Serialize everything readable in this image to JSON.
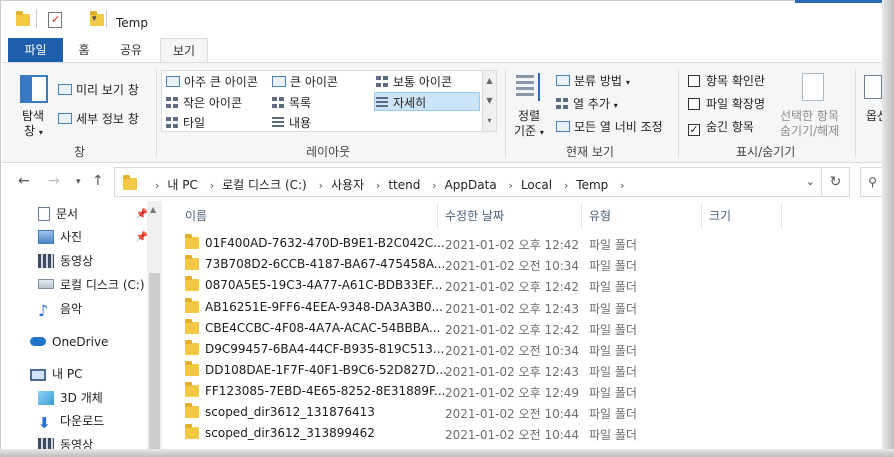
{
  "window": {
    "title": "Temp"
  },
  "tabs": {
    "file": "파일",
    "home": "홈",
    "share": "공유",
    "view": "보기"
  },
  "ribbon": {
    "pane_group": {
      "navigation_pane": "탐색",
      "navigation_pane_sub": "창",
      "preview_pane": "미리 보기 창",
      "details_pane": "세부 정보 창",
      "label": "창"
    },
    "layout_group": {
      "items": [
        "아주 큰 아이콘",
        "큰 아이콘",
        "보통 아이콘",
        "작은 아이콘",
        "목록",
        "자세히",
        "타일",
        "내용"
      ],
      "selected": "자세히",
      "label": "레이아웃"
    },
    "current_view_group": {
      "sort_by": "정렬",
      "sort_by_sub": "기준",
      "group_by": "분류 방법",
      "add_columns": "열 추가",
      "size_all_columns": "모든 열 너비 조정",
      "label": "현재 보기"
    },
    "show_hide_group": {
      "item_checkboxes": "항목 확인란",
      "file_extensions": "파일 확장명",
      "hidden_items": "숨긴 항목",
      "hide_selected": "선택한 항목",
      "hide_selected_sub": "숨기기/해제",
      "options": "옵션",
      "label": "표시/숨기기"
    },
    "checkbox_states": {
      "item_checkboxes": false,
      "file_extensions": false,
      "hidden_items": true
    }
  },
  "address": {
    "crumbs": [
      "내 PC",
      "로컬 디스크 (C:)",
      "사용자",
      "ttend",
      "AppData",
      "Local",
      "Temp"
    ]
  },
  "navpane": {
    "items": [
      {
        "label": "문서",
        "icon": "document-icon",
        "pinned": true
      },
      {
        "label": "사진",
        "icon": "pictures-icon",
        "pinned": true
      },
      {
        "label": "동영상",
        "icon": "video-icon",
        "pinned": false
      },
      {
        "label": "로컬 디스크 (C:)",
        "icon": "drive-icon",
        "pinned": false
      },
      {
        "label": "음악",
        "icon": "music-icon",
        "pinned": false
      },
      {
        "label": "OneDrive",
        "icon": "cloud-icon",
        "pinned": false
      },
      {
        "label": "내 PC",
        "icon": "computer-icon",
        "pinned": false
      },
      {
        "label": "3D 개체",
        "icon": "cube-icon",
        "pinned": false
      },
      {
        "label": "다운로드",
        "icon": "download-icon",
        "pinned": false
      },
      {
        "label": "동영상",
        "icon": "video-icon",
        "pinned": false
      }
    ]
  },
  "filelist": {
    "columns": {
      "name": "이름",
      "date": "수정한 날짜",
      "type": "유형",
      "size": "크기"
    },
    "rows": [
      {
        "name": "01F400AD-7632-470D-B9E1-B2C042C...",
        "date": "2021-01-02 오후 12:42",
        "type": "파일 폴더"
      },
      {
        "name": "73B708D2-6CCB-4187-BA67-475458A...",
        "date": "2021-01-02 오전 10:34",
        "type": "파일 폴더"
      },
      {
        "name": "0870A5E5-19C3-4A77-A61C-BDB33EF...",
        "date": "2021-01-02 오후 12:42",
        "type": "파일 폴더"
      },
      {
        "name": "AB16251E-9FF6-4EEA-9348-DA3A3B0...",
        "date": "2021-01-02 오후 12:43",
        "type": "파일 폴더"
      },
      {
        "name": "CBE4CCBC-4F08-4A7A-ACAC-54BBBA...",
        "date": "2021-01-02 오후 12:42",
        "type": "파일 폴더"
      },
      {
        "name": "D9C99457-6BA4-44CF-B935-819C513...",
        "date": "2021-01-02 오전 10:34",
        "type": "파일 폴더"
      },
      {
        "name": "DD108DAE-1F7F-40F1-B9C6-52D827D...",
        "date": "2021-01-02 오후 12:43",
        "type": "파일 폴더"
      },
      {
        "name": "FF123085-7EBD-4E65-8252-8E31889F...",
        "date": "2021-01-02 오후 12:49",
        "type": "파일 폴더"
      },
      {
        "name": "scoped_dir3612_131876413",
        "date": "2021-01-02 오전 10:44",
        "type": "파일 폴더"
      },
      {
        "name": "scoped_dir3612_313899462",
        "date": "2021-01-02 오전 10:44",
        "type": "파일 폴더"
      }
    ]
  },
  "colors": {
    "file_tab": "#1f5fae",
    "selection": "#cce4f7",
    "folder": "#f3c843"
  }
}
